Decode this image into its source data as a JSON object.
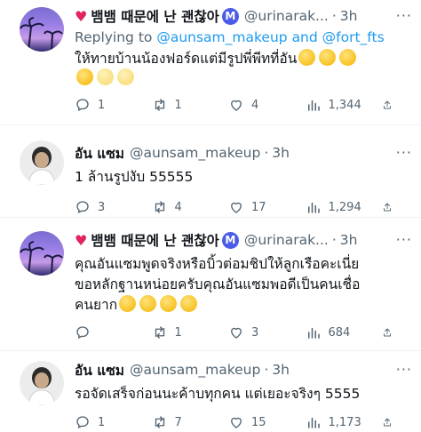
{
  "tweets": [
    {
      "name": "뱀뱀 때문에 난 괜찮아",
      "badge": "M",
      "handle": "@urinarak...",
      "time": "3h",
      "replying_prefix": "Replying to",
      "replying_to_1": "@aunsam_makeup",
      "replying_and": "and",
      "replying_to_2": "@fort_fts",
      "text": "ให้ทายบ้านน้องฟอร์ดแต่มีรูปพี่พีทที่อัน",
      "replies": "1",
      "retweets": "1",
      "likes": "4",
      "views": "1,344"
    },
    {
      "name": "อัน แซม",
      "handle": "@aunsam_makeup",
      "time": "3h",
      "text": "1 ล้านรูปงับ 55555",
      "replies": "3",
      "retweets": "4",
      "likes": "17",
      "views": "1,294"
    },
    {
      "name": "뱀뱀 때문에 난 괜찮아",
      "badge": "M",
      "handle": "@urinarak...",
      "time": "3h",
      "text_line1": "คุณอันแซมพูดจริงหรือบิ้วต่อมชิปให้ลูกเรือคะเนี่ย",
      "text_line2": "ขอหลักฐานหน่อยครับคุณอันแซมพอดีเป็นคนเชื่อ",
      "text_line3": "คนยาก",
      "replies": "",
      "retweets": "1",
      "likes": "3",
      "views": "684"
    },
    {
      "name": "อัน แซม",
      "handle": "@aunsam_makeup",
      "time": "3h",
      "text": "รอจัดเสร็จก่อนนะค้าบทุกคน แต่เยอะจริงๆ 5555",
      "replies": "1",
      "retweets": "7",
      "likes": "15",
      "views": "1,173"
    }
  ],
  "icons": [
    "reply-icon",
    "retweet-icon",
    "like-icon",
    "views-icon",
    "share-icon",
    "more-icon",
    "emoji-icon"
  ],
  "colors": {
    "accent": "#1d9bf0",
    "muted": "#536471",
    "heart": "#e0245e",
    "badge": "#4a5de8"
  }
}
